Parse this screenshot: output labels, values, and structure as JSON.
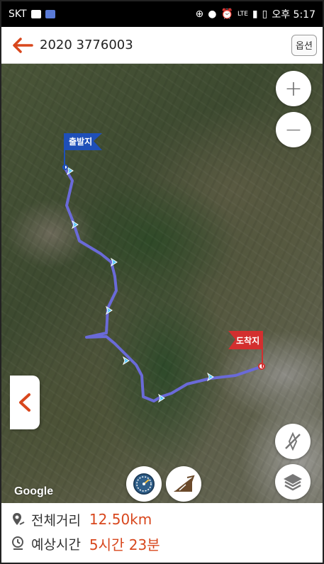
{
  "statusbar": {
    "carrier": "SKT",
    "lte": "LTE",
    "time_label": "오후 5:17",
    "icons": [
      "message-icon",
      "app-icon",
      "sync-icon",
      "location-icon",
      "alarm-icon",
      "signal-icon",
      "battery-icon"
    ]
  },
  "appbar": {
    "title": "2020 3776003",
    "options_label": "옵션",
    "back_icon": "arrow-left-icon",
    "accent_color": "#d8471d"
  },
  "map": {
    "start_label": "출발지",
    "end_label": "도착지",
    "route_color": "#6a6ad8",
    "start_flag_color": "#1e4fb8",
    "end_flag_color": "#d32f2f",
    "zoom_in": "+",
    "zoom_out": "−",
    "google_label": "Google",
    "controls": [
      "zoom-in-button",
      "zoom-out-button",
      "compass-off-button",
      "layers-button",
      "speedometer-button",
      "slope-button",
      "side-collapse-button"
    ]
  },
  "info": {
    "distance_label": "전체거리",
    "distance_value": "12.50km",
    "time_label": "예상시간",
    "time_value": "5시간 23분",
    "value_color": "#d8471d"
  }
}
